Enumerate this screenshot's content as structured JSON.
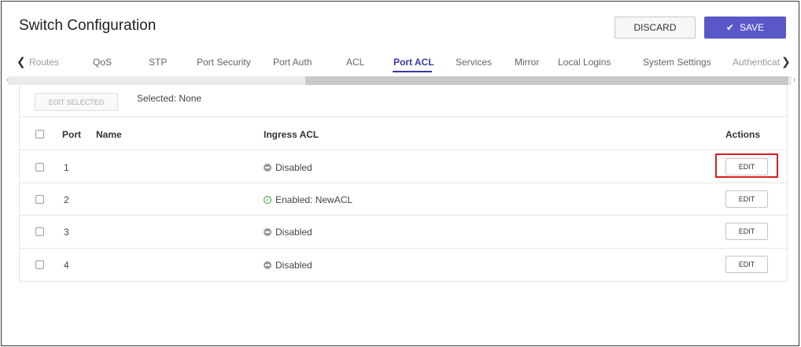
{
  "header": {
    "title": "Switch Configuration",
    "discard_label": "DISCARD",
    "save_label": "SAVE"
  },
  "tabs": [
    {
      "label": "Routes",
      "active": false
    },
    {
      "label": "QoS",
      "active": false
    },
    {
      "label": "STP",
      "active": false
    },
    {
      "label": "Port Security",
      "active": false
    },
    {
      "label": "Port Auth",
      "active": false
    },
    {
      "label": "ACL",
      "active": false
    },
    {
      "label": "Port ACL",
      "active": true
    },
    {
      "label": "Services",
      "active": false
    },
    {
      "label": "Mirror",
      "active": false
    },
    {
      "label": "Local Logins",
      "active": false
    },
    {
      "label": "System Settings",
      "active": false
    },
    {
      "label": "Authenticat",
      "active": false
    }
  ],
  "toolbar": {
    "edit_selected_label": "EDIT SELECTED",
    "selected_text": "Selected: None"
  },
  "table": {
    "columns": {
      "port": "Port",
      "name": "Name",
      "ingress_acl": "Ingress ACL",
      "actions": "Actions"
    },
    "rows": [
      {
        "port": "1",
        "name": "",
        "ingress_acl": "Disabled",
        "status": "disabled",
        "action": "EDIT"
      },
      {
        "port": "2",
        "name": "",
        "ingress_acl": "Enabled: NewACL",
        "status": "enabled",
        "action": "EDIT"
      },
      {
        "port": "3",
        "name": "",
        "ingress_acl": "Disabled",
        "status": "disabled",
        "action": "EDIT"
      },
      {
        "port": "4",
        "name": "",
        "ingress_acl": "Disabled",
        "status": "disabled",
        "action": "EDIT"
      }
    ]
  },
  "colors": {
    "accent": "#5a57c8",
    "active_tab": "#3b38a8",
    "enabled_status": "#2e9e3a",
    "disabled_status": "#9a9a9a",
    "highlight": "#d81e1e"
  },
  "icons": {
    "save": "check-icon",
    "tab_prev": "chevron-left-icon",
    "tab_next": "chevron-right-icon",
    "status_disabled": "minus-circle-icon",
    "status_enabled": "check-circle-icon"
  }
}
